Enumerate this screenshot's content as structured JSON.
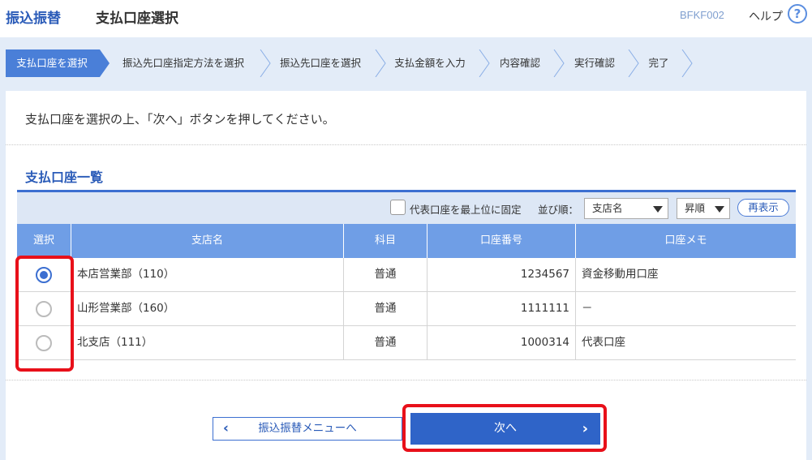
{
  "header": {
    "brand": "振込振替",
    "title": "支払口座選択",
    "screen_id": "BFKF002",
    "help_label": "ヘルプ",
    "help_icon": "?"
  },
  "steps": [
    {
      "label": "支払口座を選択",
      "active": true
    },
    {
      "label": "振込先口座指定方法を選択",
      "active": false
    },
    {
      "label": "振込先口座を選択",
      "active": false
    },
    {
      "label": "支払金額を入力",
      "active": false
    },
    {
      "label": "内容確認",
      "active": false
    },
    {
      "label": "実行確認",
      "active": false
    },
    {
      "label": "完了",
      "active": false
    }
  ],
  "instruction": "支払口座を選択の上、「次へ」ボタンを押してください。",
  "section_title": "支払口座一覧",
  "toolbar": {
    "pin_label": "代表口座を最上位に固定",
    "pin_checked": false,
    "sort_label": "並び順：",
    "sort_field": "支店名",
    "sort_order": "昇順",
    "redisplay_label": "再表示"
  },
  "table": {
    "headers": [
      "選択",
      "支店名",
      "科目",
      "口座番号",
      "口座メモ"
    ],
    "rows": [
      {
        "selected": true,
        "branch": "本店営業部（110）",
        "type": "普通",
        "number": "1234567",
        "memo": "資金移動用口座"
      },
      {
        "selected": false,
        "branch": "山形営業部（160）",
        "type": "普通",
        "number": "1111111",
        "memo": "－"
      },
      {
        "selected": false,
        "branch": "北支店（111）",
        "type": "普通",
        "number": "1000314",
        "memo": "代表口座"
      }
    ]
  },
  "buttons": {
    "back_label": "振込振替メニューへ",
    "back_icon": "‹",
    "next_label": "次へ",
    "next_icon": "›"
  },
  "colors": {
    "accent": "#2f64c8",
    "step_active": "#4a7fd8",
    "highlight": "#e8101a",
    "table_header": "#6f9ee6"
  }
}
